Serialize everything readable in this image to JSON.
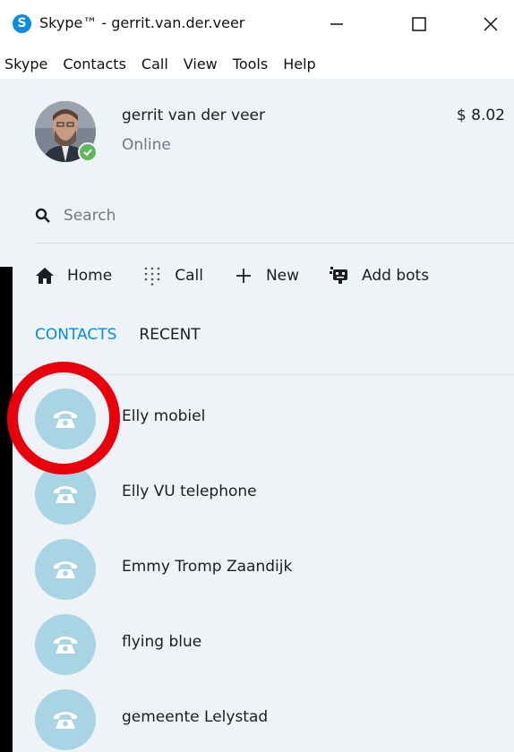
{
  "window": {
    "logo_letter": "S",
    "title": "Skype™ - gerrit.van.der.veer"
  },
  "menu": [
    "Skype",
    "Contacts",
    "Call",
    "View",
    "Tools",
    "Help"
  ],
  "profile": {
    "name": "gerrit van der veer",
    "status": "Online",
    "credit": "$ 8.02",
    "status_color": "#5cb85c"
  },
  "search": {
    "placeholder": "Search"
  },
  "nav": {
    "home": "Home",
    "call": "Call",
    "new": "New",
    "add_bots": "Add bots"
  },
  "tabs": {
    "contacts": "CONTACTS",
    "recent": "RECENT",
    "active_color": "#0a8be0"
  },
  "contacts": [
    {
      "name": "Elly mobiel",
      "icon": "phone-icon"
    },
    {
      "name": "Elly VU telephone",
      "icon": "phone-icon"
    },
    {
      "name": "Emmy Tromp Zaandijk",
      "icon": "phone-icon"
    },
    {
      "name": "flying blue",
      "icon": "phone-icon"
    },
    {
      "name": "gemeente Lelystad",
      "icon": "phone-icon"
    }
  ],
  "annotation": {
    "ring_color": "#e8000c"
  }
}
